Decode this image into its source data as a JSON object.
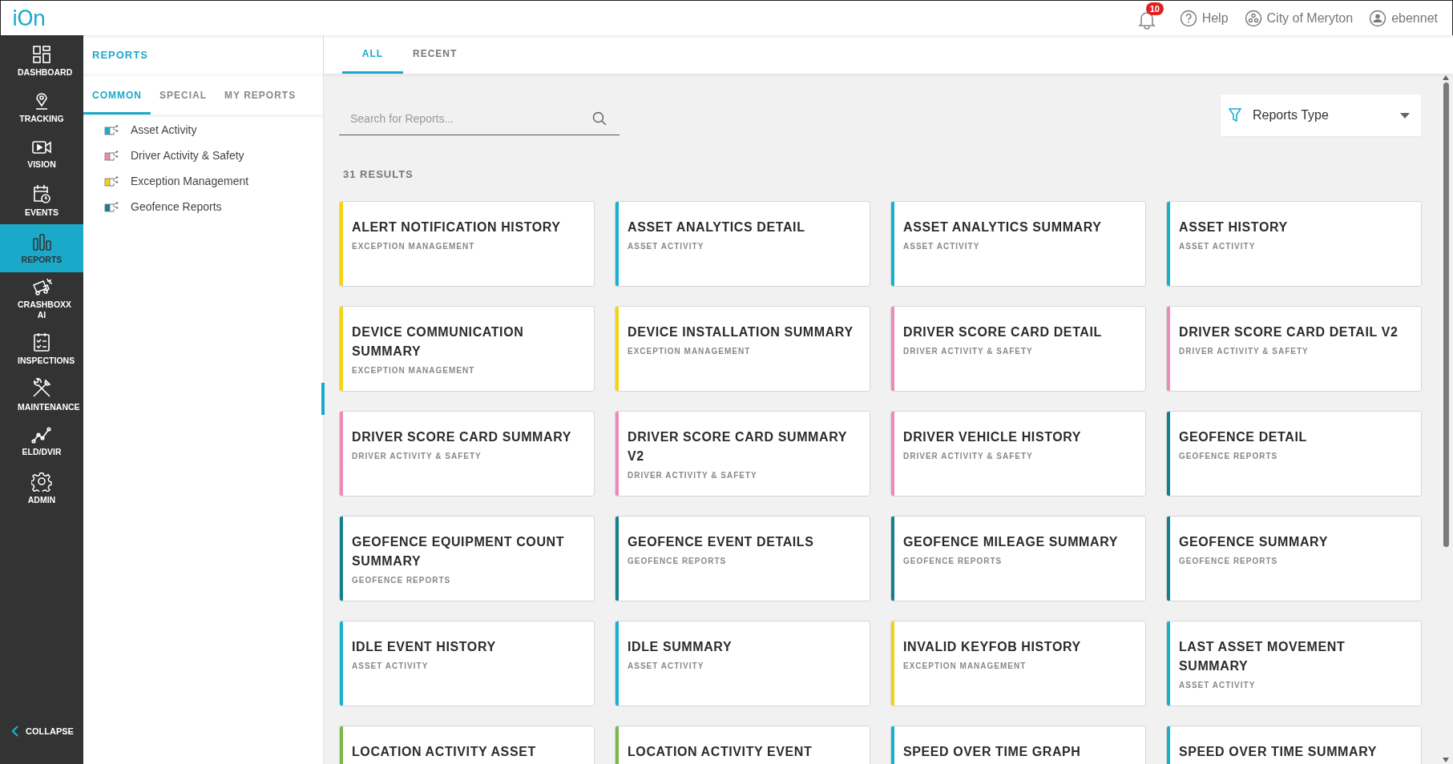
{
  "header": {
    "logo": "iOn",
    "notifications": "10",
    "help": "Help",
    "organization": "City of Meryton",
    "user": "ebennet"
  },
  "sidebar": {
    "items": [
      {
        "label": "DASHBOARD",
        "selected": false
      },
      {
        "label": "TRACKING",
        "selected": false
      },
      {
        "label": "VISION",
        "selected": false
      },
      {
        "label": "EVENTS",
        "selected": false
      },
      {
        "label": "REPORTS",
        "selected": true
      },
      {
        "label": "CRASHBOXX AI",
        "selected": false
      },
      {
        "label": "INSPECTIONS",
        "selected": false
      },
      {
        "label": "MAINTENANCE",
        "selected": false
      },
      {
        "label": "ELD/DVIR",
        "selected": false
      },
      {
        "label": "ADMIN",
        "selected": false
      }
    ],
    "collapse": "COLLAPSE"
  },
  "panel": {
    "title": "REPORTS",
    "tabs": [
      {
        "label": "COMMON",
        "selected": true
      },
      {
        "label": "SPECIAL",
        "selected": false
      },
      {
        "label": "MY REPORTS",
        "selected": false
      }
    ],
    "categories": [
      {
        "label": "Asset Activity",
        "color": "#1ab0cf"
      },
      {
        "label": "Driver Activity & Safety",
        "color": "#ec8bb8"
      },
      {
        "label": "Exception Management",
        "color": "#f5d312"
      },
      {
        "label": "Geofence Reports",
        "color": "#137f8f"
      }
    ]
  },
  "main": {
    "tabs": [
      {
        "label": "ALL",
        "selected": true
      },
      {
        "label": "RECENT",
        "selected": false
      }
    ],
    "search": {
      "placeholder": "Search for Reports..."
    },
    "filter": {
      "label": "Reports Type"
    },
    "results": "31 RESULTS",
    "cards": [
      {
        "title": "ALERT NOTIFICATION HISTORY",
        "category": "EXCEPTION MANAGEMENT",
        "color": "#f5d312"
      },
      {
        "title": "ASSET ANALYTICS DETAIL",
        "category": "ASSET ACTIVITY",
        "color": "#1ab0cf"
      },
      {
        "title": "ASSET ANALYTICS SUMMARY",
        "category": "ASSET ACTIVITY",
        "color": "#1ab0cf"
      },
      {
        "title": "ASSET HISTORY",
        "category": "ASSET ACTIVITY",
        "color": "#1ab0cf"
      },
      {
        "title": "DEVICE COMMUNICATION SUMMARY",
        "category": "EXCEPTION MANAGEMENT",
        "color": "#f5d312"
      },
      {
        "title": "DEVICE INSTALLATION SUMMARY",
        "category": "EXCEPTION MANAGEMENT",
        "color": "#f5d312"
      },
      {
        "title": "DRIVER SCORE CARD DETAIL",
        "category": "DRIVER ACTIVITY & SAFETY",
        "color": "#ec8bb8"
      },
      {
        "title": "DRIVER SCORE CARD DETAIL V2",
        "category": "DRIVER ACTIVITY & SAFETY",
        "color": "#ec8bb8"
      },
      {
        "title": "DRIVER SCORE CARD SUMMARY",
        "category": "DRIVER ACTIVITY & SAFETY",
        "color": "#ec8bb8"
      },
      {
        "title": "DRIVER SCORE CARD SUMMARY V2",
        "category": "DRIVER ACTIVITY & SAFETY",
        "color": "#ec8bb8"
      },
      {
        "title": "DRIVER VEHICLE HISTORY",
        "category": "DRIVER ACTIVITY & SAFETY",
        "color": "#ec8bb8"
      },
      {
        "title": "GEOFENCE DETAIL",
        "category": "GEOFENCE REPORTS",
        "color": "#137f8f"
      },
      {
        "title": "GEOFENCE EQUIPMENT COUNT SUMMARY",
        "category": "GEOFENCE REPORTS",
        "color": "#137f8f"
      },
      {
        "title": "GEOFENCE EVENT DETAILS",
        "category": "GEOFENCE REPORTS",
        "color": "#137f8f"
      },
      {
        "title": "GEOFENCE MILEAGE SUMMARY",
        "category": "GEOFENCE REPORTS",
        "color": "#137f8f"
      },
      {
        "title": "GEOFENCE SUMMARY",
        "category": "GEOFENCE REPORTS",
        "color": "#137f8f"
      },
      {
        "title": "IDLE EVENT HISTORY",
        "category": "ASSET ACTIVITY",
        "color": "#1ab0cf"
      },
      {
        "title": "IDLE SUMMARY",
        "category": "ASSET ACTIVITY",
        "color": "#1ab0cf"
      },
      {
        "title": "INVALID KEYFOB HISTORY",
        "category": "EXCEPTION MANAGEMENT",
        "color": "#f5d312"
      },
      {
        "title": "LAST ASSET MOVEMENT SUMMARY",
        "category": "ASSET ACTIVITY",
        "color": "#1ab0cf"
      },
      {
        "title": "LOCATION ACTIVITY ASSET",
        "color": "#7ab648"
      },
      {
        "title": "LOCATION ACTIVITY EVENT",
        "color": "#7ab648"
      },
      {
        "title": "SPEED OVER TIME GRAPH",
        "color": "#1ab0cf"
      },
      {
        "title": "SPEED OVER TIME SUMMARY",
        "color": "#1ab0cf"
      }
    ]
  }
}
